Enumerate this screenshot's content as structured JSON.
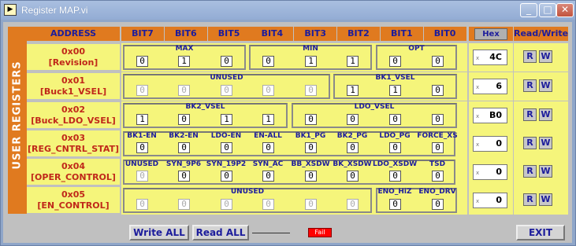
{
  "window": {
    "title": "Register MAP.vi",
    "app_icon": "labview-icon"
  },
  "header": {
    "address": "ADDRESS",
    "bits": [
      "BIT7",
      "BIT6",
      "BIT5",
      "BIT4",
      "BIT3",
      "BIT2",
      "BIT1",
      "BIT0"
    ],
    "hex_button": "Hex",
    "read_write": "Read/Write"
  },
  "side_label": "USER REGISTERS",
  "registers": [
    {
      "addr": "0x00",
      "name": "[Revision]",
      "groups": [
        "MAX",
        "MIN",
        "OPT"
      ],
      "bits": [
        "0",
        "1",
        "0",
        "0",
        "1",
        "1",
        "0",
        "0"
      ],
      "hex": "4C"
    },
    {
      "addr": "0x01",
      "name": "[Buck1_VSEL]",
      "groups": [
        "UNUSED",
        "BK1_VSEL"
      ],
      "bits": [
        "0",
        "0",
        "0",
        "0",
        "0",
        "1",
        "1",
        "0"
      ],
      "hex": "6"
    },
    {
      "addr": "0x02",
      "name": "[Buck_LDO_VSEL]",
      "groups": [
        "BK2_VSEL",
        "LDO_VSEL"
      ],
      "bits": [
        "1",
        "0",
        "1",
        "1",
        "0",
        "0",
        "0",
        "0"
      ],
      "hex": "B0"
    },
    {
      "addr": "0x03",
      "name": "[REG_CNTRL_STAT]",
      "labels": [
        "BK1-EN",
        "BK2-EN",
        "LDO-EN",
        "EN-ALL",
        "BK1_PG",
        "BK2_PG",
        "LDO_PG",
        "FORCE_XS"
      ],
      "bits": [
        "0",
        "0",
        "0",
        "0",
        "0",
        "0",
        "0",
        "0"
      ],
      "hex": "0"
    },
    {
      "addr": "0x04",
      "name": "[OPER_CONTROL]",
      "labels": [
        "UNUSED",
        "SYN_9P6",
        "SYN_19P2",
        "SYN_AC",
        "BB_XSDW",
        "BK_XSDW",
        "LDO_XSDW",
        "TSD"
      ],
      "bits": [
        "0",
        "0",
        "0",
        "0",
        "0",
        "0",
        "0",
        "0"
      ],
      "hex": "0"
    },
    {
      "addr": "0x05",
      "name": "[EN_CONTROL]",
      "groups": [
        "UNUSED"
      ],
      "labels2": [
        "ENO_HiZ",
        "ENO_DRV"
      ],
      "bits": [
        "0",
        "0",
        "0",
        "0",
        "0",
        "0",
        "0",
        "0"
      ],
      "hex": "0"
    }
  ],
  "rw_buttons": {
    "read": "R",
    "write": "W"
  },
  "hex_prefix": "x",
  "footer": {
    "write_all": "Write ALL",
    "read_all": "Read ALL",
    "status": "Fail",
    "exit": "EXIT"
  },
  "colors": {
    "header_orange": "#e07a1f",
    "cell_yellow": "#f5f57b",
    "label_blue": "#1c1c9c",
    "addr_red": "#c0281a",
    "status_fail": "#ff0000"
  }
}
